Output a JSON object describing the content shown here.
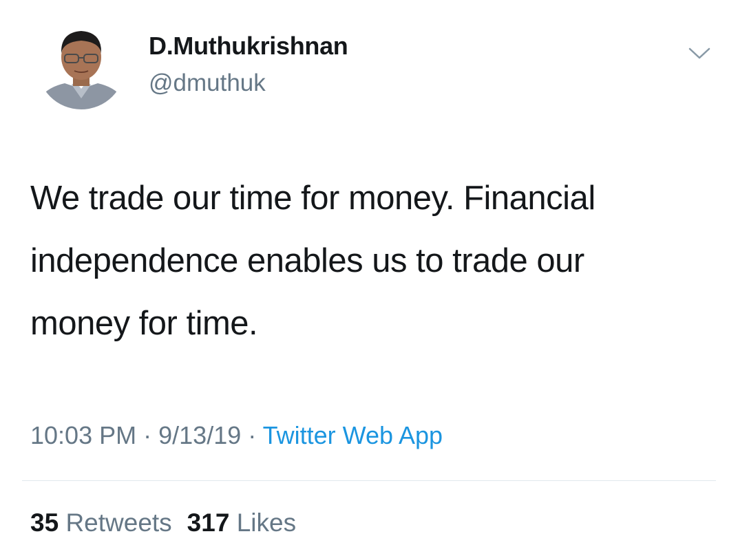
{
  "user": {
    "display_name": "D.Muthukrishnan",
    "handle": "@dmuthuk",
    "avatar_icon": "profile-photo"
  },
  "header": {
    "menu_icon": "chevron-down-icon"
  },
  "tweet": {
    "lines": [
      "We trade our time for money. Financial",
      "independence enables us to trade our",
      "money for time."
    ]
  },
  "meta": {
    "time": "10:03 PM",
    "separator": "·",
    "date": "9/13/19",
    "source": "Twitter Web App"
  },
  "stats": {
    "retweets_count": "35",
    "retweets_label": "Retweets",
    "likes_count": "317",
    "likes_label": "Likes"
  },
  "colors": {
    "text": "#14171a",
    "secondary": "#657786",
    "link": "#1b95e0",
    "divider": "#e1e8ed"
  }
}
